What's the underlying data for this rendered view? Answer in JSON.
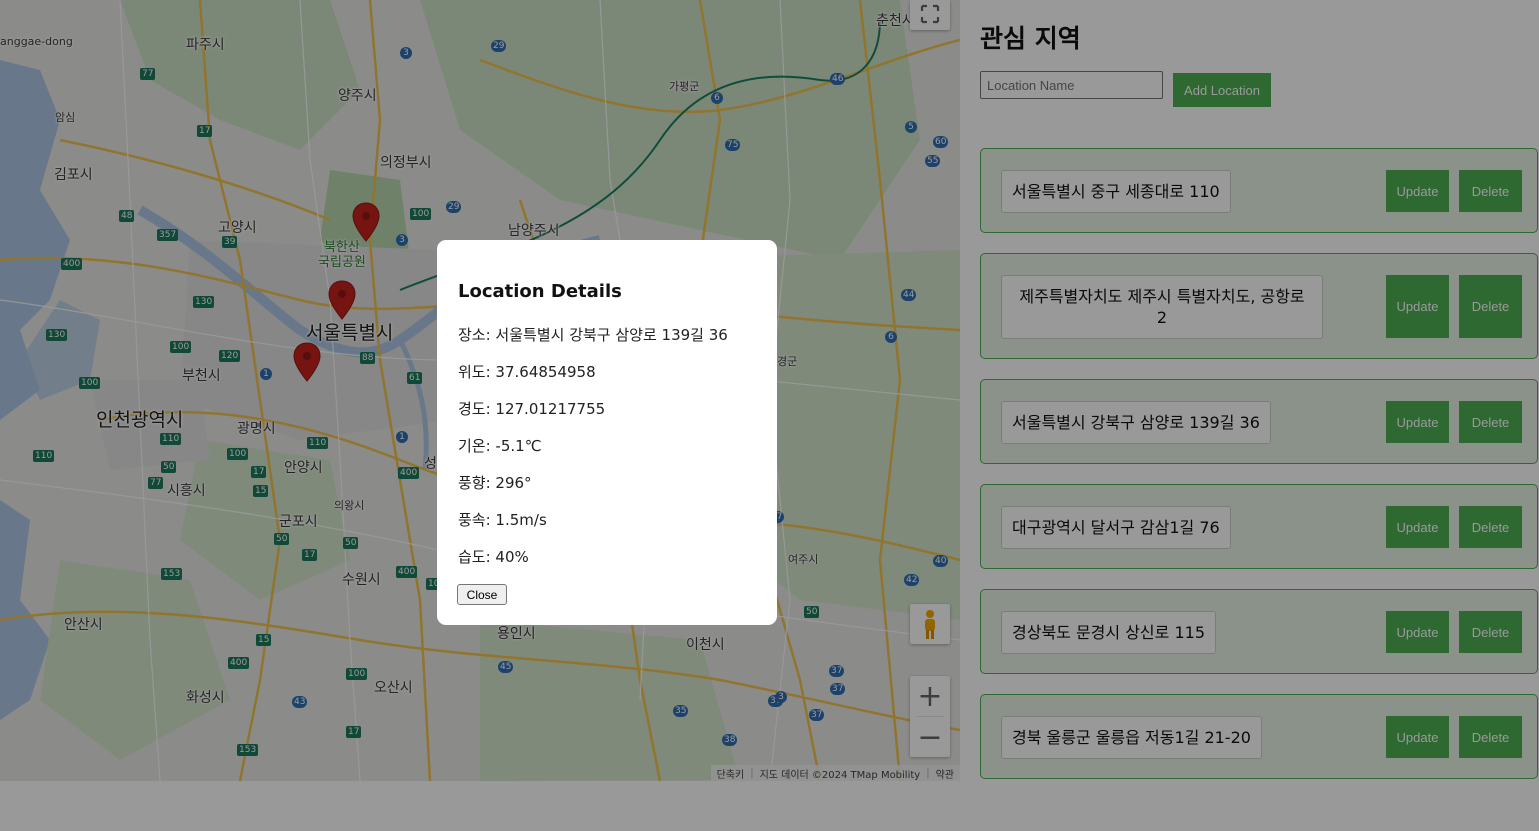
{
  "map": {
    "places": [
      {
        "name": "anggae-dong",
        "size": "small"
      },
      {
        "name": "파주시"
      },
      {
        "name": "양주시"
      },
      {
        "name": "가평군",
        "size": "small"
      },
      {
        "name": "춘천시"
      },
      {
        "name": "의정부시"
      },
      {
        "name": "김포시"
      },
      {
        "name": "고양시"
      },
      {
        "name": "남양주시"
      },
      {
        "name": "서울특별시",
        "size": "big"
      },
      {
        "name": "부천시"
      },
      {
        "name": "인천광역시",
        "size": "big"
      },
      {
        "name": "광명시"
      },
      {
        "name": "안양시"
      },
      {
        "name": "시흥시"
      },
      {
        "name": "의왕시",
        "size": "small"
      },
      {
        "name": "군포시"
      },
      {
        "name": "수원시"
      },
      {
        "name": "안산시"
      },
      {
        "name": "용인시"
      },
      {
        "name": "이천시"
      },
      {
        "name": "여주시",
        "size": "small"
      },
      {
        "name": "오산시"
      },
      {
        "name": "화성시"
      },
      {
        "name": "암심",
        "size": "small"
      },
      {
        "name": "성"
      },
      {
        "name": "경군",
        "size": "small"
      }
    ],
    "park_label": "북한산\n국립공원",
    "route_shields": [
      "3",
      "29",
      "77",
      "46",
      "17",
      "6",
      "75",
      "5",
      "60",
      "55",
      "100",
      "29",
      "48",
      "357",
      "39",
      "400",
      "130",
      "100",
      "3",
      "120",
      "1",
      "88",
      "61",
      "130",
      "100",
      "400",
      "110",
      "17",
      "110",
      "1",
      "110",
      "50",
      "15",
      "100",
      "77",
      "50",
      "17",
      "153",
      "50",
      "100",
      "42",
      "37",
      "400",
      "15",
      "100",
      "45",
      "43",
      "17",
      "153",
      "35",
      "38",
      "37",
      "40",
      "400",
      "44",
      "6",
      "37",
      "50",
      "37",
      "37",
      "3"
    ],
    "attribution": {
      "shortcut": "단축키",
      "data": "지도 데이터 ©2024 TMap Mobility",
      "terms": "약관"
    },
    "controls": {
      "zoom_in": "+",
      "zoom_out": "−"
    }
  },
  "panel": {
    "title": "관심 지역",
    "input_placeholder": "Location Name",
    "add_button": "Add Location",
    "update_label": "Update",
    "delete_label": "Delete",
    "locations": [
      {
        "address": "서울특별시 중구 세종대로 110"
      },
      {
        "address": "제주특별자치도 제주시 특별자치도, 공항로 2"
      },
      {
        "address": "서울특별시 강북구 삼양로 139길 36"
      },
      {
        "address": "대구광역시 달서구 감삼1길 76"
      },
      {
        "address": "경상북도 문경시 상신로 115"
      },
      {
        "address": "경북 울릉군 울릉읍 저동1길 21-20"
      }
    ]
  },
  "modal": {
    "title": "Location Details",
    "place": "장소: 서울특별시 강북구 삼양로 139길 36",
    "latitude": "위도: 37.64854958",
    "longitude": "경도: 127.01217755",
    "temperature": "기온: -5.1℃",
    "wind_direction": "풍향: 296°",
    "wind_speed": "풍속: 1.5m/s",
    "humidity": "습도: 40%",
    "close_label": "Close"
  },
  "colors": {
    "accent": "#4caf50",
    "card_bg": "#e6f4e6",
    "marker": "#c5221f"
  }
}
